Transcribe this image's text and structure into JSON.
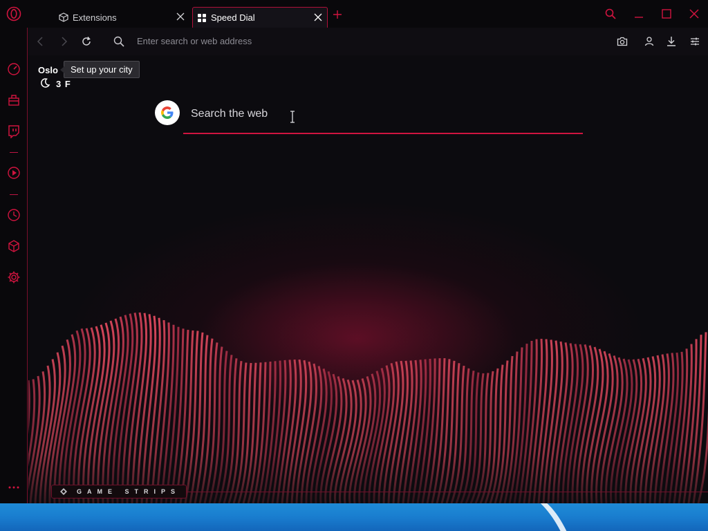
{
  "tabs": [
    {
      "label": "Extensions",
      "icon": "cube-icon",
      "active": false
    },
    {
      "label": "Speed Dial",
      "icon": "grid-icon",
      "active": true
    }
  ],
  "address_bar": {
    "placeholder": "Enter search or web address"
  },
  "weather": {
    "city": "Oslo",
    "temperature": "3 F",
    "tooltip": "Set up your city"
  },
  "search": {
    "placeholder": "Search the web",
    "engine": "Google"
  },
  "game_strips": {
    "label": "GAME STRIPS"
  },
  "sidebar": {
    "items": [
      "speedometer-icon",
      "bag-icon",
      "twitch-icon",
      "player-icon",
      "history-icon",
      "extensions-cube-icon",
      "settings-gear-icon",
      "more-dots-icon"
    ]
  },
  "colors": {
    "accent": "#d0143f",
    "background": "#0c0b0f",
    "panel": "#09080b",
    "taskbar": "#1a7fd0"
  }
}
